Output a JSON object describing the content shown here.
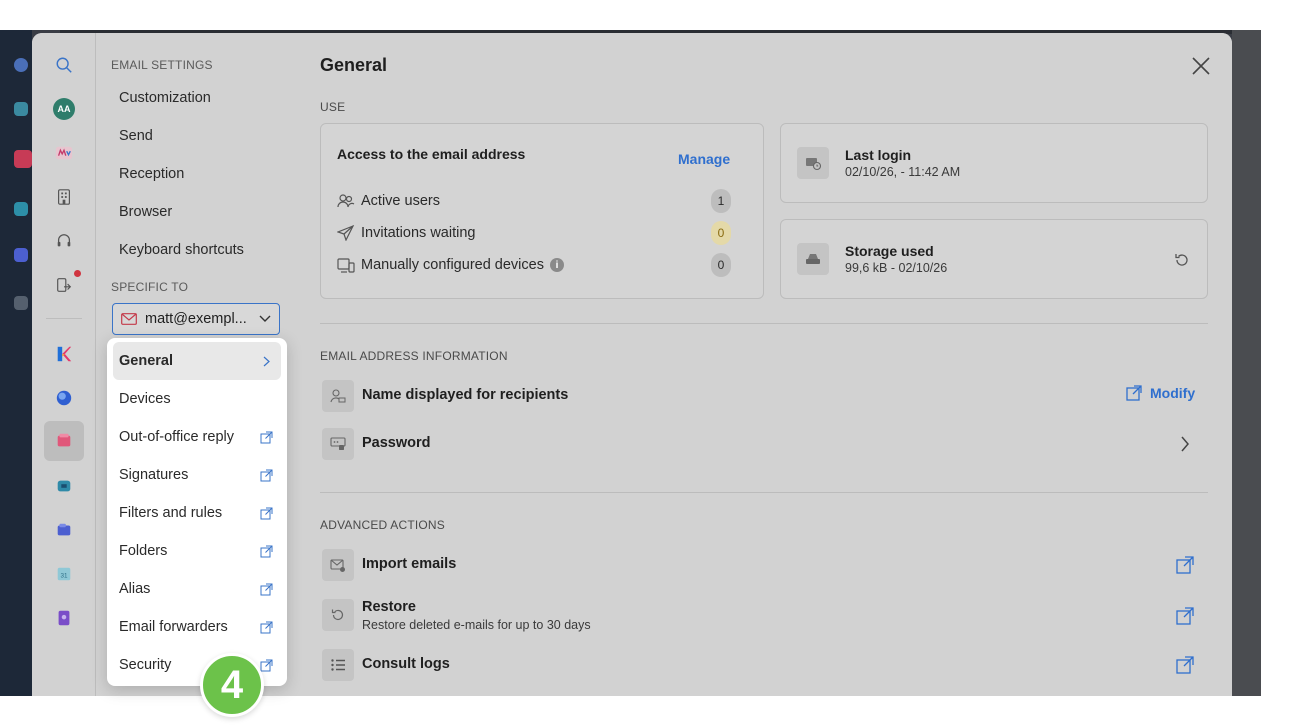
{
  "colors": {
    "accent": "#2f6fce",
    "modal_bg": "#d2d2d2",
    "badge_green": "#6cc24a",
    "alert_dot": "#d0343f",
    "warning_count_bg": "#e4d9a8"
  },
  "rail": {
    "avatar_initials": "AA",
    "icons": [
      "search-icon",
      "avatar",
      "my-app-icon",
      "building-icon",
      "headset-icon",
      "device-transfer-icon",
      "kchat-app-icon",
      "sphere-app-icon",
      "mail-app-icon",
      "drive-app-icon",
      "chat-app-icon",
      "calendar-app-icon",
      "contacts-app-icon"
    ]
  },
  "nav": {
    "section_email_settings": "EMAIL SETTINGS",
    "items": [
      "Customization",
      "Send",
      "Reception",
      "Browser",
      "Keyboard shortcuts"
    ],
    "section_specific_to": "SPECIFIC TO",
    "account_select_value": "matt@exempl..."
  },
  "menu": {
    "items": [
      {
        "label": "General",
        "selected": true,
        "icon": "chevron-right-icon"
      },
      {
        "label": "Devices",
        "selected": false,
        "icon": ""
      },
      {
        "label": "Out-of-office reply",
        "selected": false,
        "icon": "external-link-icon"
      },
      {
        "label": "Signatures",
        "selected": false,
        "icon": "external-link-icon"
      },
      {
        "label": "Filters and rules",
        "selected": false,
        "icon": "external-link-icon"
      },
      {
        "label": "Folders",
        "selected": false,
        "icon": "external-link-icon"
      },
      {
        "label": "Alias",
        "selected": false,
        "icon": "external-link-icon"
      },
      {
        "label": "Email forwarders",
        "selected": false,
        "icon": "external-link-icon"
      },
      {
        "label": "Security",
        "selected": false,
        "icon": "external-link-icon"
      }
    ]
  },
  "step_badge": "4",
  "main": {
    "title": "General",
    "use": {
      "section_label": "USE",
      "access_card": {
        "title": "Access to the email address",
        "manage_label": "Manage",
        "rows": [
          {
            "label": "Active users",
            "count": "1"
          },
          {
            "label": "Invitations waiting",
            "count": "0"
          },
          {
            "label": "Manually configured devices",
            "count": "0",
            "info": "i"
          }
        ]
      },
      "last_login": {
        "title": "Last login",
        "value": "02/10/26, - 11:42 AM"
      },
      "storage": {
        "title": "Storage used",
        "value": "99,6 kB - 02/10/26"
      }
    },
    "address_info": {
      "section_label": "EMAIL ADDRESS INFORMATION",
      "display_name": {
        "title": "Name displayed for recipients",
        "action_label": "Modify"
      },
      "password": {
        "title": "Password"
      }
    },
    "advanced": {
      "section_label": "ADVANCED ACTIONS",
      "import": {
        "title": "Import emails"
      },
      "restore": {
        "title": "Restore",
        "subtitle": "Restore deleted e-mails for up to 30 days"
      },
      "logs": {
        "title": "Consult logs"
      }
    }
  }
}
